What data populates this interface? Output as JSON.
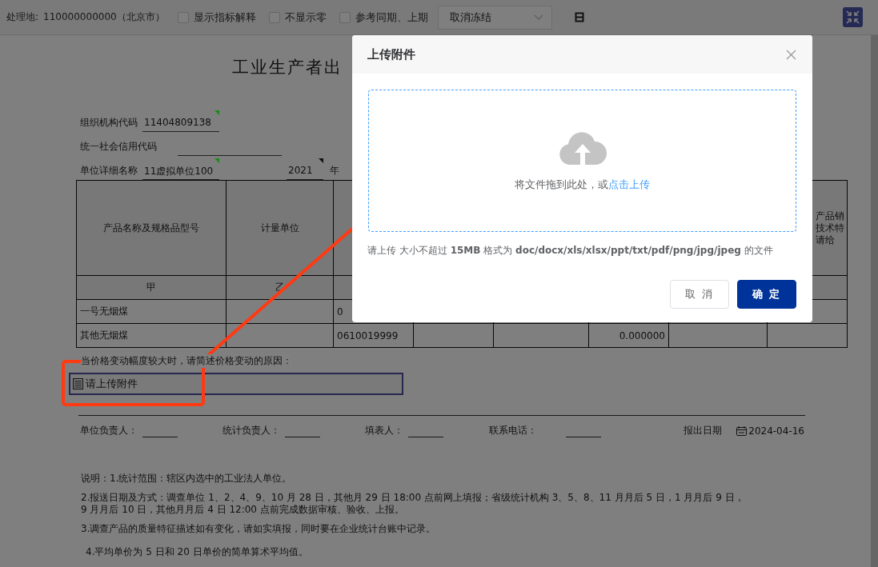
{
  "toolbar": {
    "location_label": "处理地:",
    "location_value": "110000000000（北京市）",
    "checkboxes": [
      {
        "label": "显示指标解释",
        "checked": false
      },
      {
        "label": "不显示零",
        "checked": false
      },
      {
        "label": "参考同期、上期",
        "checked": false
      }
    ],
    "dropdown": {
      "value": "取消冻结"
    }
  },
  "form": {
    "title": "工业生产者出",
    "fields": [
      {
        "label": "组织机构代码",
        "value": "11404809138",
        "color": "#1a8a1a"
      },
      {
        "label": "统一社会信用代码"
      },
      {
        "label": "单位详细名称",
        "value": "11虚拟单位100",
        "color": "#1a8a1a"
      }
    ],
    "year": {
      "value": "2021",
      "unit": "年",
      "color": "#111111"
    }
  },
  "table": {
    "columns": [
      {
        "lines": [
          "产品名称及规格品型号"
        ]
      },
      {
        "lines": [
          "计量单位"
        ]
      },
      {},
      {},
      {},
      {},
      {},
      {
        "lines": [
          "产品销",
          "技术特",
          "请给"
        ]
      }
    ],
    "code_row": [
      "甲",
      "乙"
    ],
    "rows": [
      {
        "name": "一号无烟煤",
        "code": "0"
      },
      {
        "name": "其他无烟煤",
        "code": "0610019999",
        "column_6": "0.000000"
      }
    ]
  },
  "reason": {
    "prompt": "当价格变动幅度较大时，请简述价格变动的原因：",
    "attachment": "请上传附件"
  },
  "signatures": [
    {
      "label": "单位负责人："
    },
    {
      "label": "统计负责人："
    },
    {
      "label": "填表人："
    },
    {
      "label": "联系电话："
    }
  ],
  "report_date": {
    "label": "报出日期",
    "value": "2024-04-16"
  },
  "notes": [
    "说明：1.统计范围：辖区内选中的工业法人单位。",
    "2.报送日期及方式：调查单位 1、2、4、9、10 月 28 日，其他月 29 日 18:00 点前网上填报；省级统计机构 3、5、8、11 月月后 5 日，1 月月后 9 日，9 月月后 10 日，其他月月后 4 日 12:00 点前完成数据审核、验收、上报。",
    "3.调查产品的质量特征描述如有变化，请如实填报，同时要在企业统计台账中记录。",
    "4.平均单价为 5 日和 20 日单价的简单算术平均值。"
  ],
  "dialog": {
    "title": "上传附件",
    "drop_text": "将文件拖到此处，或",
    "drop_link": "点击上传",
    "hint": "请上传 大小不超过 **15MB** 格式为 **doc/docx/xls/xlsx/ppt/txt/pdf/png/jpg/jpeg** 的文件",
    "buttons": [
      {
        "label": "取 消",
        "kind": "secondary"
      },
      {
        "label": "确 定",
        "kind": "primary"
      }
    ]
  }
}
